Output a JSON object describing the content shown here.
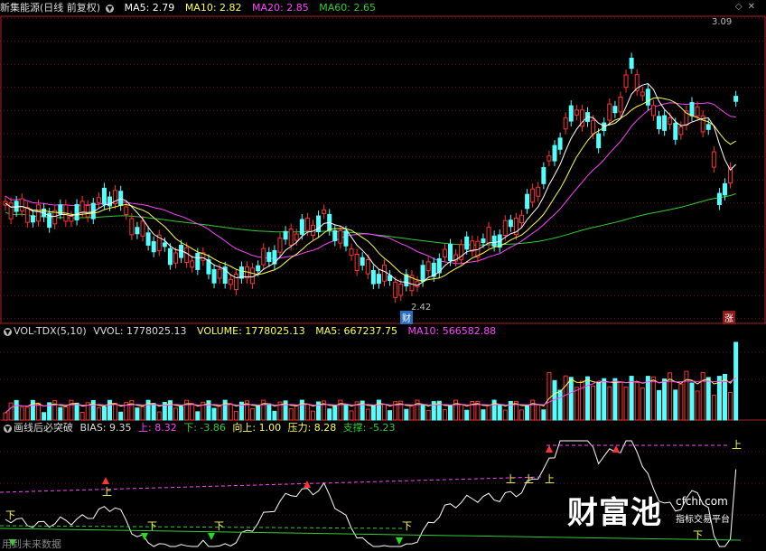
{
  "main": {
    "title": "新集能源(日线 前复权)",
    "ma5": "MA5: 2.79",
    "ma10": "MA10: 2.82",
    "ma20": "MA20: 2.85",
    "ma60": "MA60: 2.65",
    "high_label": "3.09",
    "low_label": "2.42",
    "event_badge": "财",
    "corner_badge": "涨"
  },
  "volume": {
    "title": "VOL-TDX(5,10)",
    "vvol": "VVOL: 1778025.13",
    "volume": "VOLUME: 1778025.13",
    "ma5": "MA5: 667237.75",
    "ma10": "MA10: 566582.88"
  },
  "indicator": {
    "title": "画线后必突破",
    "bias": "BIAS: 9.35",
    "up": "上: 8.32",
    "down": "下: -3.86",
    "upward": "向上: 1.00",
    "pressure": "压力: 8.28",
    "support": "支撑: -5.23",
    "up_mark": "上",
    "down_mark": "下"
  },
  "footer": {
    "future_data": "用到未来数据"
  },
  "watermark": {
    "brand": "财富池",
    "site": "cfchi.com",
    "slogan": "指标交易平台"
  },
  "colors": {
    "up": "#ff3333",
    "down": "#54ffff",
    "ma5": "#ffffff",
    "ma10": "#ffff55",
    "ma20": "#ff44ff",
    "ma60": "#33cc33",
    "bias": "#ffffff",
    "pressure": "#ff44ff",
    "support": "#33cc33",
    "grid": "#7a1010"
  },
  "chart_data": [
    {
      "type": "candlestick",
      "title": "新集能源(日线 前复权)",
      "high": 3.09,
      "low": 2.42,
      "series": [
        {
          "name": "MA5",
          "values": [
            2.79
          ]
        },
        {
          "name": "MA10",
          "values": [
            2.82
          ]
        },
        {
          "name": "MA20",
          "values": [
            2.85
          ]
        },
        {
          "name": "MA60",
          "values": [
            2.65
          ]
        }
      ]
    },
    {
      "type": "bar",
      "title": "VOL-TDX(5,10)",
      "series": [
        {
          "name": "VOLUME",
          "values": [
            1778025.13
          ]
        },
        {
          "name": "MA5",
          "values": [
            667237.75
          ]
        },
        {
          "name": "MA10",
          "values": [
            566582.88
          ]
        }
      ]
    },
    {
      "type": "line",
      "title": "画线后必突破",
      "series": [
        {
          "name": "BIAS",
          "values": [
            9.35
          ]
        },
        {
          "name": "上",
          "values": [
            8.32
          ]
        },
        {
          "name": "下",
          "values": [
            -3.86
          ]
        },
        {
          "name": "向上",
          "values": [
            1.0
          ]
        },
        {
          "name": "压力",
          "values": [
            8.28
          ]
        },
        {
          "name": "支撑",
          "values": [
            -5.23
          ]
        }
      ]
    }
  ]
}
